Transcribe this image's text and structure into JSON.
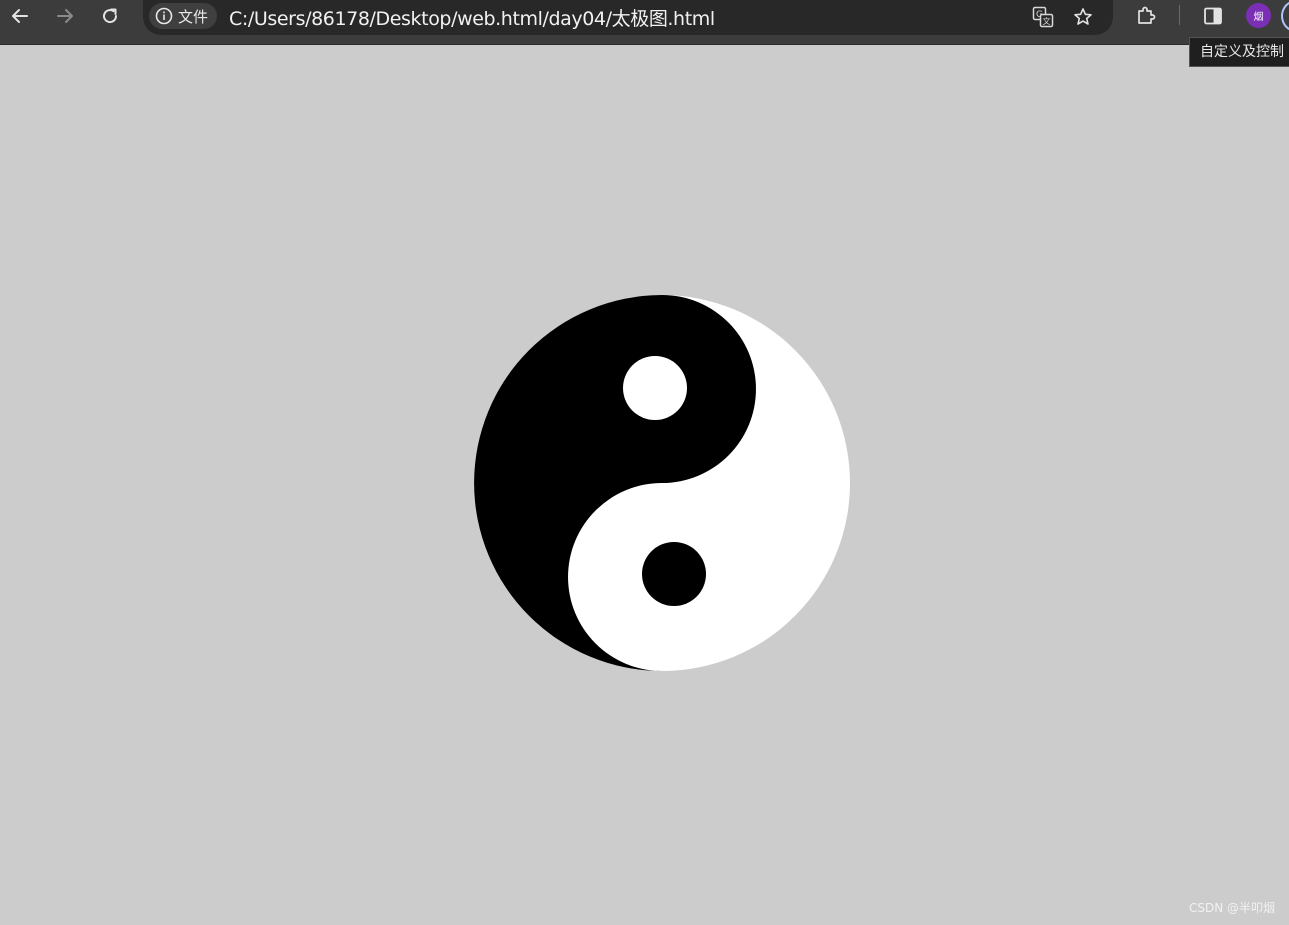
{
  "browser": {
    "file_chip_label": "文件",
    "url": "C:/Users/86178/Desktop/web.html/day04/太极图.html",
    "profile_initial": "烟",
    "tooltip": "自定义及控制"
  },
  "icons": {
    "back": "back-arrow-icon",
    "forward": "forward-arrow-icon",
    "reload": "reload-icon",
    "info": "info-icon",
    "translate": "translate-icon",
    "bookmark": "star-icon",
    "extensions": "puzzle-icon",
    "side_panel": "side-panel-icon"
  },
  "page": {
    "background": "#cccccc",
    "yin_color": "#000000",
    "yang_color": "#ffffff"
  },
  "watermark": "CSDN @半叩烟"
}
